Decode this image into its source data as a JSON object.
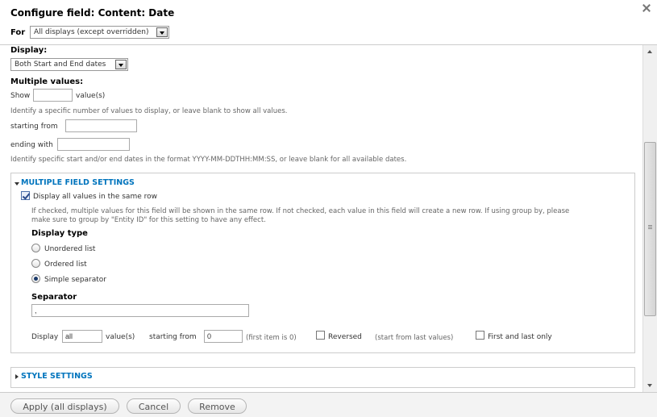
{
  "dialog": {
    "title": "Configure field: Content: Date",
    "for_label": "For",
    "for_value": "All displays (except overridden)"
  },
  "display": {
    "label": "Display:",
    "value": "Both Start and End dates"
  },
  "multiple_values": {
    "label": "Multiple values:",
    "show_label": "Show",
    "show_value": "",
    "show_suffix": "value(s)",
    "show_desc": "Identify a specific number of values to display, or leave blank to show all values.",
    "starting_from_label": "starting from",
    "starting_from_value": "",
    "ending_with_label": "ending with",
    "ending_with_value": "",
    "dates_desc": "Identify specific start and/or end dates in the format YYYY-MM-DDTHH:MM:SS, or leave blank for all available dates."
  },
  "multiple_field_settings": {
    "legend": "MULTIPLE FIELD SETTINGS",
    "same_row_label": "Display all values in the same row",
    "same_row_checked": true,
    "same_row_desc_1": "If checked, multiple values for this field will be shown in the same row. If not checked, each value in this field will create a new row. If using group by, please",
    "same_row_desc_2": "make sure to group by \"Entity ID\" for this setting to have any effect.",
    "display_type_label": "Display type",
    "display_types": [
      {
        "label": "Unordered list",
        "checked": false
      },
      {
        "label": "Ordered list",
        "checked": false
      },
      {
        "label": "Simple separator",
        "checked": true
      }
    ],
    "separator_label": "Separator",
    "separator_value": ",",
    "delta_display_label": "Display",
    "delta_display_value": "all",
    "delta_values_suffix": "value(s)",
    "delta_starting_label": "starting from",
    "delta_starting_value": "0",
    "delta_first_item_note": "(first item is 0)",
    "reversed_label": "Reversed",
    "reversed_note": "(start from last values)",
    "first_last_label": "First and last only"
  },
  "style_settings": {
    "legend": "STYLE SETTINGS"
  },
  "buttons": {
    "apply": "Apply (all displays)",
    "cancel": "Cancel",
    "remove": "Remove"
  },
  "colors": {
    "link_blue": "#0074bd",
    "border_gray": "#cccccc"
  }
}
